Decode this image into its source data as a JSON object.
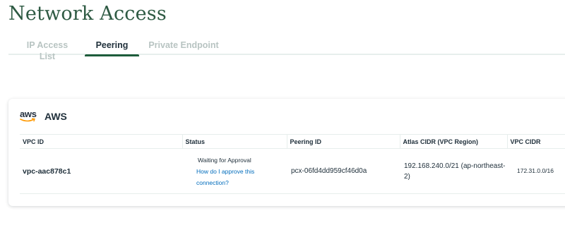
{
  "page": {
    "title": "Network Access"
  },
  "tabs": [
    {
      "label": "IP Access List",
      "active": false
    },
    {
      "label": "Peering",
      "active": true
    },
    {
      "label": "Private Endpoint",
      "active": false
    }
  ],
  "colors": {
    "title": "#2e5a43",
    "active_tab_underline": "#1e5c3b",
    "link": "#006cbc",
    "inactive_tab": "#b8c4c2"
  },
  "provider": {
    "logo_text": "aws",
    "logo_icon": "aws-logo-icon",
    "name": "AWS"
  },
  "table": {
    "headers": [
      "VPC ID",
      "Status",
      "Peering ID",
      "Atlas CIDR (VPC Region)",
      "VPC CIDR"
    ],
    "rows": [
      {
        "vpc_id": "vpc-aac878c1",
        "status": "Waiting for Approval",
        "status_link": "How do I approve this connection?",
        "peering_id": "pcx-06fd4dd959cf46d0a",
        "atlas_cidr": "192.168.240.0/21 (ap-northeast-2)",
        "vpc_cidr": "172.31.0.0/16"
      }
    ]
  }
}
